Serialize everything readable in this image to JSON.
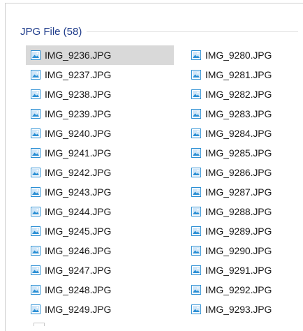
{
  "group": {
    "title": "JPG File (58)"
  },
  "icon": "jpg-image-file-icon",
  "columns": [
    {
      "items": [
        {
          "name": "IMG_9236.JPG",
          "selected": true
        },
        {
          "name": "IMG_9237.JPG"
        },
        {
          "name": "IMG_9238.JPG"
        },
        {
          "name": "IMG_9239.JPG"
        },
        {
          "name": "IMG_9240.JPG"
        },
        {
          "name": "IMG_9241.JPG"
        },
        {
          "name": "IMG_9242.JPG"
        },
        {
          "name": "IMG_9243.JPG"
        },
        {
          "name": "IMG_9244.JPG"
        },
        {
          "name": "IMG_9245.JPG"
        },
        {
          "name": "IMG_9246.JPG"
        },
        {
          "name": "IMG_9247.JPG"
        },
        {
          "name": "IMG_9248.JPG"
        },
        {
          "name": "IMG_9249.JPG"
        }
      ]
    },
    {
      "items": [
        {
          "name": "IMG_9280.JPG"
        },
        {
          "name": "IMG_9281.JPG"
        },
        {
          "name": "IMG_9282.JPG"
        },
        {
          "name": "IMG_9283.JPG"
        },
        {
          "name": "IMG_9284.JPG"
        },
        {
          "name": "IMG_9285.JPG"
        },
        {
          "name": "IMG_9286.JPG"
        },
        {
          "name": "IMG_9287.JPG"
        },
        {
          "name": "IMG_9288.JPG"
        },
        {
          "name": "IMG_9289.JPG"
        },
        {
          "name": "IMG_9290.JPG"
        },
        {
          "name": "IMG_9291.JPG"
        },
        {
          "name": "IMG_9292.JPG"
        },
        {
          "name": "IMG_9293.JPG"
        }
      ]
    }
  ],
  "colors": {
    "group_title": "#1e3b8a",
    "selection": "#d9d9d9",
    "icon_blue": "#2b8fd4"
  }
}
